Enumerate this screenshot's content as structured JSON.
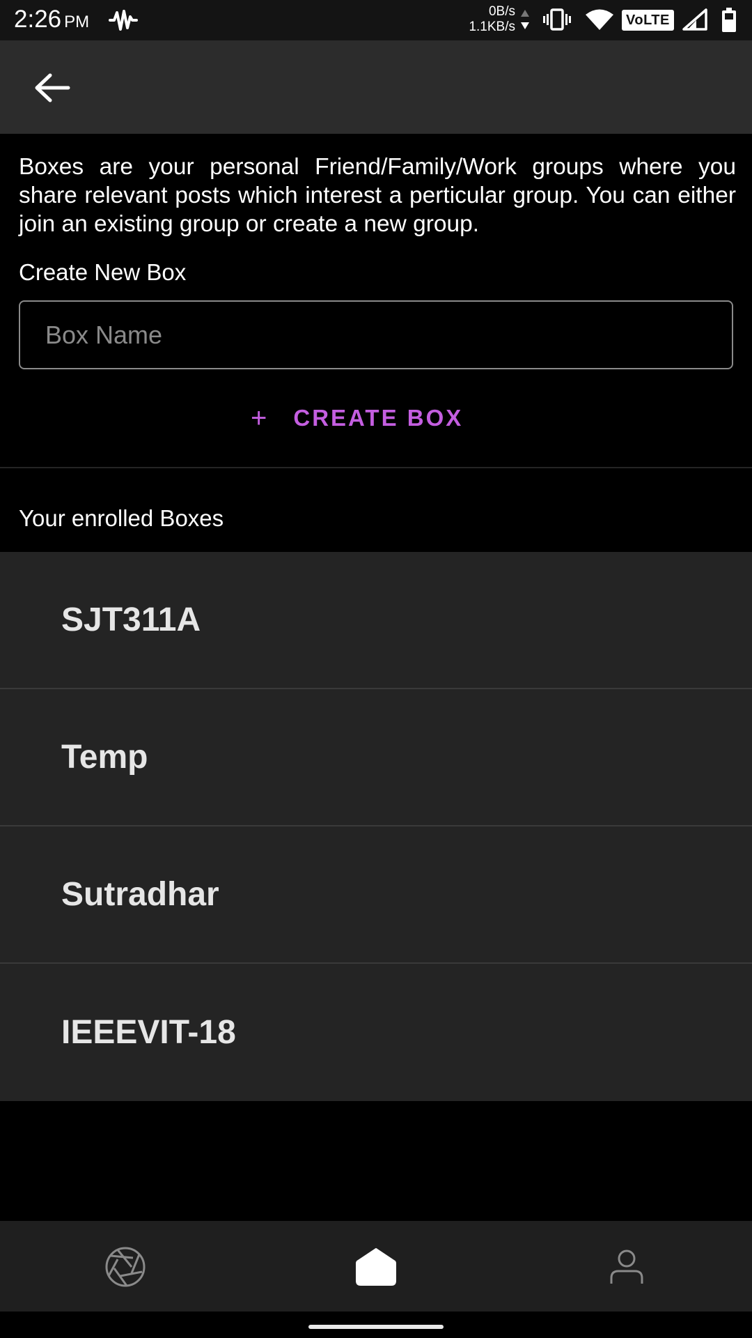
{
  "status_bar": {
    "time": "2:26",
    "ampm": "PM",
    "net_up": "0B/s",
    "net_down": "1.1KB/s",
    "volte": "VoLTE",
    "icons": [
      "pulse-icon",
      "data-arrows-icon",
      "vibrate-icon",
      "wifi-icon",
      "volte-icon",
      "cell-signal-icon",
      "battery-icon"
    ]
  },
  "app_bar": {
    "back_icon": "arrow-left-icon"
  },
  "content": {
    "description": "Boxes are your personal Friend/Family/Work groups where you share relevant posts which interest a perticular group. You can either join an existing group or create a new group.",
    "create_label": "Create New Box",
    "box_name_placeholder": "Box Name",
    "box_name_value": "",
    "create_button_label": "CREATE BOX",
    "create_button_icon": "plus-icon",
    "enrolled_header": "Your enrolled Boxes"
  },
  "boxes": [
    {
      "label": "SJT311A"
    },
    {
      "label": "Temp"
    },
    {
      "label": "Sutradhar"
    },
    {
      "label": "IEEEVIT-18"
    }
  ],
  "bottom_nav": {
    "items": [
      {
        "icon": "camera-aperture-icon",
        "active": false
      },
      {
        "icon": "home-icon",
        "active": true
      },
      {
        "icon": "profile-icon",
        "active": false
      }
    ]
  },
  "colors": {
    "accent": "#c45ee0",
    "background": "#000000",
    "surface": "#242424",
    "app_bar": "#2c2c2c"
  }
}
